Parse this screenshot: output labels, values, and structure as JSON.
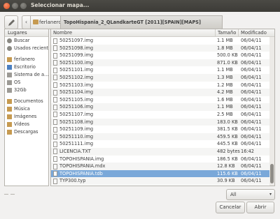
{
  "window": {
    "title": "Seleccionar mapa..."
  },
  "pathbar": {
    "back_glyph": "‹",
    "crumbs": [
      "ferlanero",
      "TopoHispania_2_QLandkarteGT [2011][SPAIN][MAPS]"
    ]
  },
  "sidebar": {
    "header": "Lugares",
    "items": [
      {
        "label": "Buscar",
        "icon": "search-icon"
      },
      {
        "label": "Usados reciente",
        "icon": "recent-icon"
      },
      {
        "label": "ferlanero",
        "icon": "home-folder-icon"
      },
      {
        "label": "Escritorio",
        "icon": "desktop-icon"
      },
      {
        "label": "Sistema de a…",
        "icon": "drive-icon"
      },
      {
        "label": "OS",
        "icon": "drive-icon"
      },
      {
        "label": "32Gb",
        "icon": "drive-icon"
      },
      {
        "label": "Documentos",
        "icon": "folder-icon"
      },
      {
        "label": "Música",
        "icon": "folder-icon"
      },
      {
        "label": "Imágenes",
        "icon": "folder-icon"
      },
      {
        "label": "Vídeos",
        "icon": "folder-icon"
      },
      {
        "label": "Descargas",
        "icon": "folder-icon"
      }
    ]
  },
  "filelist": {
    "columns": {
      "name": "Nombre",
      "size": "Tamaño",
      "modified": "Modificado"
    },
    "rows": [
      {
        "name": "50251097.img",
        "size": "1.1 MB",
        "modified": "06/04/11"
      },
      {
        "name": "50251098.img",
        "size": "1.8 MB",
        "modified": "06/04/11"
      },
      {
        "name": "50251099.img",
        "size": "500.0 KB",
        "modified": "06/04/11"
      },
      {
        "name": "50251100.img",
        "size": "871.0 KB",
        "modified": "06/04/11"
      },
      {
        "name": "50251101.img",
        "size": "1.1 MB",
        "modified": "06/04/11"
      },
      {
        "name": "50251102.img",
        "size": "1.3 MB",
        "modified": "06/04/11"
      },
      {
        "name": "50251103.img",
        "size": "1.2 MB",
        "modified": "06/04/11"
      },
      {
        "name": "50251104.img",
        "size": "4.2 MB",
        "modified": "06/04/11"
      },
      {
        "name": "50251105.img",
        "size": "1.6 MB",
        "modified": "06/04/11"
      },
      {
        "name": "50251106.img",
        "size": "1.1 MB",
        "modified": "06/04/11"
      },
      {
        "name": "50251107.img",
        "size": "2.5 MB",
        "modified": "06/04/11"
      },
      {
        "name": "50251108.img",
        "size": "183.0 KB",
        "modified": "06/04/11"
      },
      {
        "name": "50251109.img",
        "size": "381.5 KB",
        "modified": "06/04/11"
      },
      {
        "name": "50251110.img",
        "size": "459.5 KB",
        "modified": "06/04/11"
      },
      {
        "name": "50251111.img",
        "size": "445.5 KB",
        "modified": "06/04/11"
      },
      {
        "name": "LICENCIA.TXT",
        "size": "482 bytes",
        "modified": "16:42"
      },
      {
        "name": "TOPOHISPANIA.img",
        "size": "186.5 KB",
        "modified": "06/04/11"
      },
      {
        "name": "TOPOHISPANIA.mdx",
        "size": "12.8 KB",
        "modified": "06/04/11"
      },
      {
        "name": "TOPOHISPANIA.tdb",
        "size": "115.6 KB",
        "modified": "06/04/11",
        "selected": true
      },
      {
        "name": "TYP300.typ",
        "size": "30.9 KB",
        "modified": "06/04/11"
      }
    ]
  },
  "filter": {
    "selected": "All",
    "arrow": "▾"
  },
  "buttons": {
    "cancel": "Cancelar",
    "open": "Abrir"
  },
  "colors": {
    "selection": "#7aa8d9",
    "titlebar": "#3c3b37",
    "close_button": "#df4a16"
  }
}
